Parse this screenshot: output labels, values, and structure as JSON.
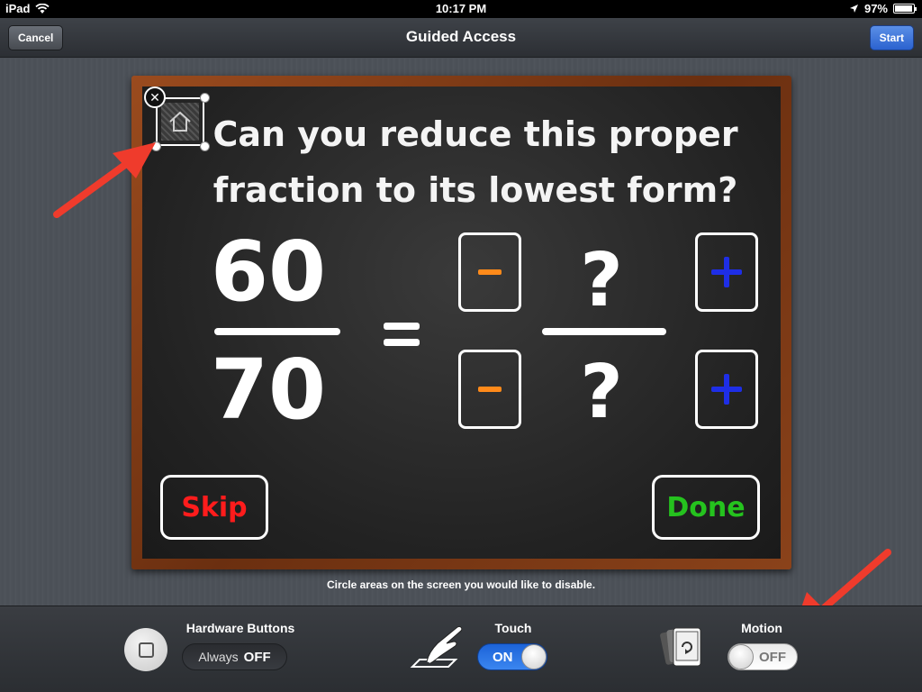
{
  "status_bar": {
    "device": "iPad",
    "time": "10:17 PM",
    "battery": "97%",
    "battery_level": 0.97
  },
  "nav": {
    "title": "Guided Access",
    "cancel_label": "Cancel",
    "start_label": "Start"
  },
  "app": {
    "question": "Can you reduce this proper fraction to its lowest form?",
    "numerator": "60",
    "denominator": "70",
    "unknown_numerator": "?",
    "unknown_denominator": "?",
    "skip_label": "Skip",
    "done_label": "Done"
  },
  "hint": "Circle areas on the screen you would like to disable.",
  "toolbar": {
    "hardware_label": "Hardware Buttons",
    "hardware_always": "Always",
    "hardware_state": "OFF",
    "touch_label": "Touch",
    "touch_state": "ON",
    "motion_label": "Motion",
    "motion_state": "OFF"
  },
  "colors": {
    "start_blue": "#2b62cf",
    "skip_red": "#ff1c1c",
    "done_green": "#25c21e",
    "minus_orange": "#ff8a1a",
    "plus_blue": "#1e2ee6",
    "arrow_red": "#ef3b2c"
  },
  "icons": {
    "wifi": "wifi-icon",
    "location": "location-arrow-icon",
    "home": "home-icon",
    "close": "close-icon",
    "hardware": "square-button-icon",
    "touch": "hand-touch-icon",
    "motion": "rotate-device-icon"
  }
}
